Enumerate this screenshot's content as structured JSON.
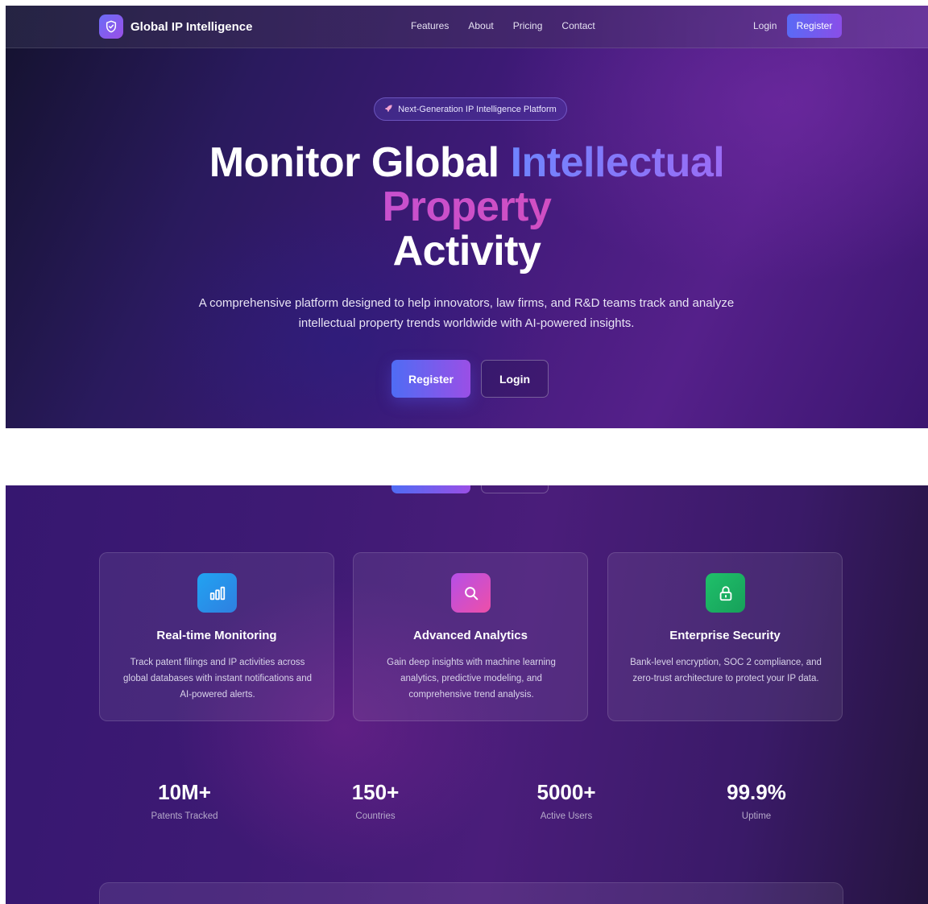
{
  "nav": {
    "brand": "Global IP Intelligence",
    "links": [
      "Features",
      "About",
      "Pricing",
      "Contact"
    ],
    "login": "Login",
    "register": "Register"
  },
  "hero": {
    "badge_icon": "rocket-icon",
    "badge": "Next-Generation IP Intelligence Platform",
    "title": {
      "part1": "Monitor Global",
      "part2": "Intellectual",
      "part3": "Property",
      "part4": "Activity"
    },
    "description": "A comprehensive platform designed to help innovators, law firms, and R&D teams track and analyze intellectual property trends worldwide with AI-powered insights.",
    "register": "Register",
    "login": "Login"
  },
  "features": [
    {
      "icon": "bar-chart-icon",
      "color": "#1e9bea",
      "title": "Real-time Monitoring",
      "description": "Track patent filings and IP activities across global databases with instant notifications and AI-powered alerts."
    },
    {
      "icon": "search-icon",
      "color": "#d84bd0",
      "title": "Advanced Analytics",
      "description": "Gain deep insights with machine learning analytics, predictive modeling, and comprehensive trend analysis."
    },
    {
      "icon": "lock-icon",
      "color": "#22b866",
      "title": "Enterprise Security",
      "description": "Bank-level encryption, SOC 2 compliance, and zero-trust architecture to protect your IP data."
    }
  ],
  "stats": [
    {
      "value": "10M+",
      "label": "Patents Tracked"
    },
    {
      "value": "150+",
      "label": "Countries"
    },
    {
      "value": "5000+",
      "label": "Active Users"
    },
    {
      "value": "99.9%",
      "label": "Uptime"
    }
  ],
  "colors": {
    "accent_start": "#4f6cf4",
    "accent_end": "#9a4fe6",
    "title_blue": "#6f85ff",
    "title_pink": "#e64ca8"
  }
}
